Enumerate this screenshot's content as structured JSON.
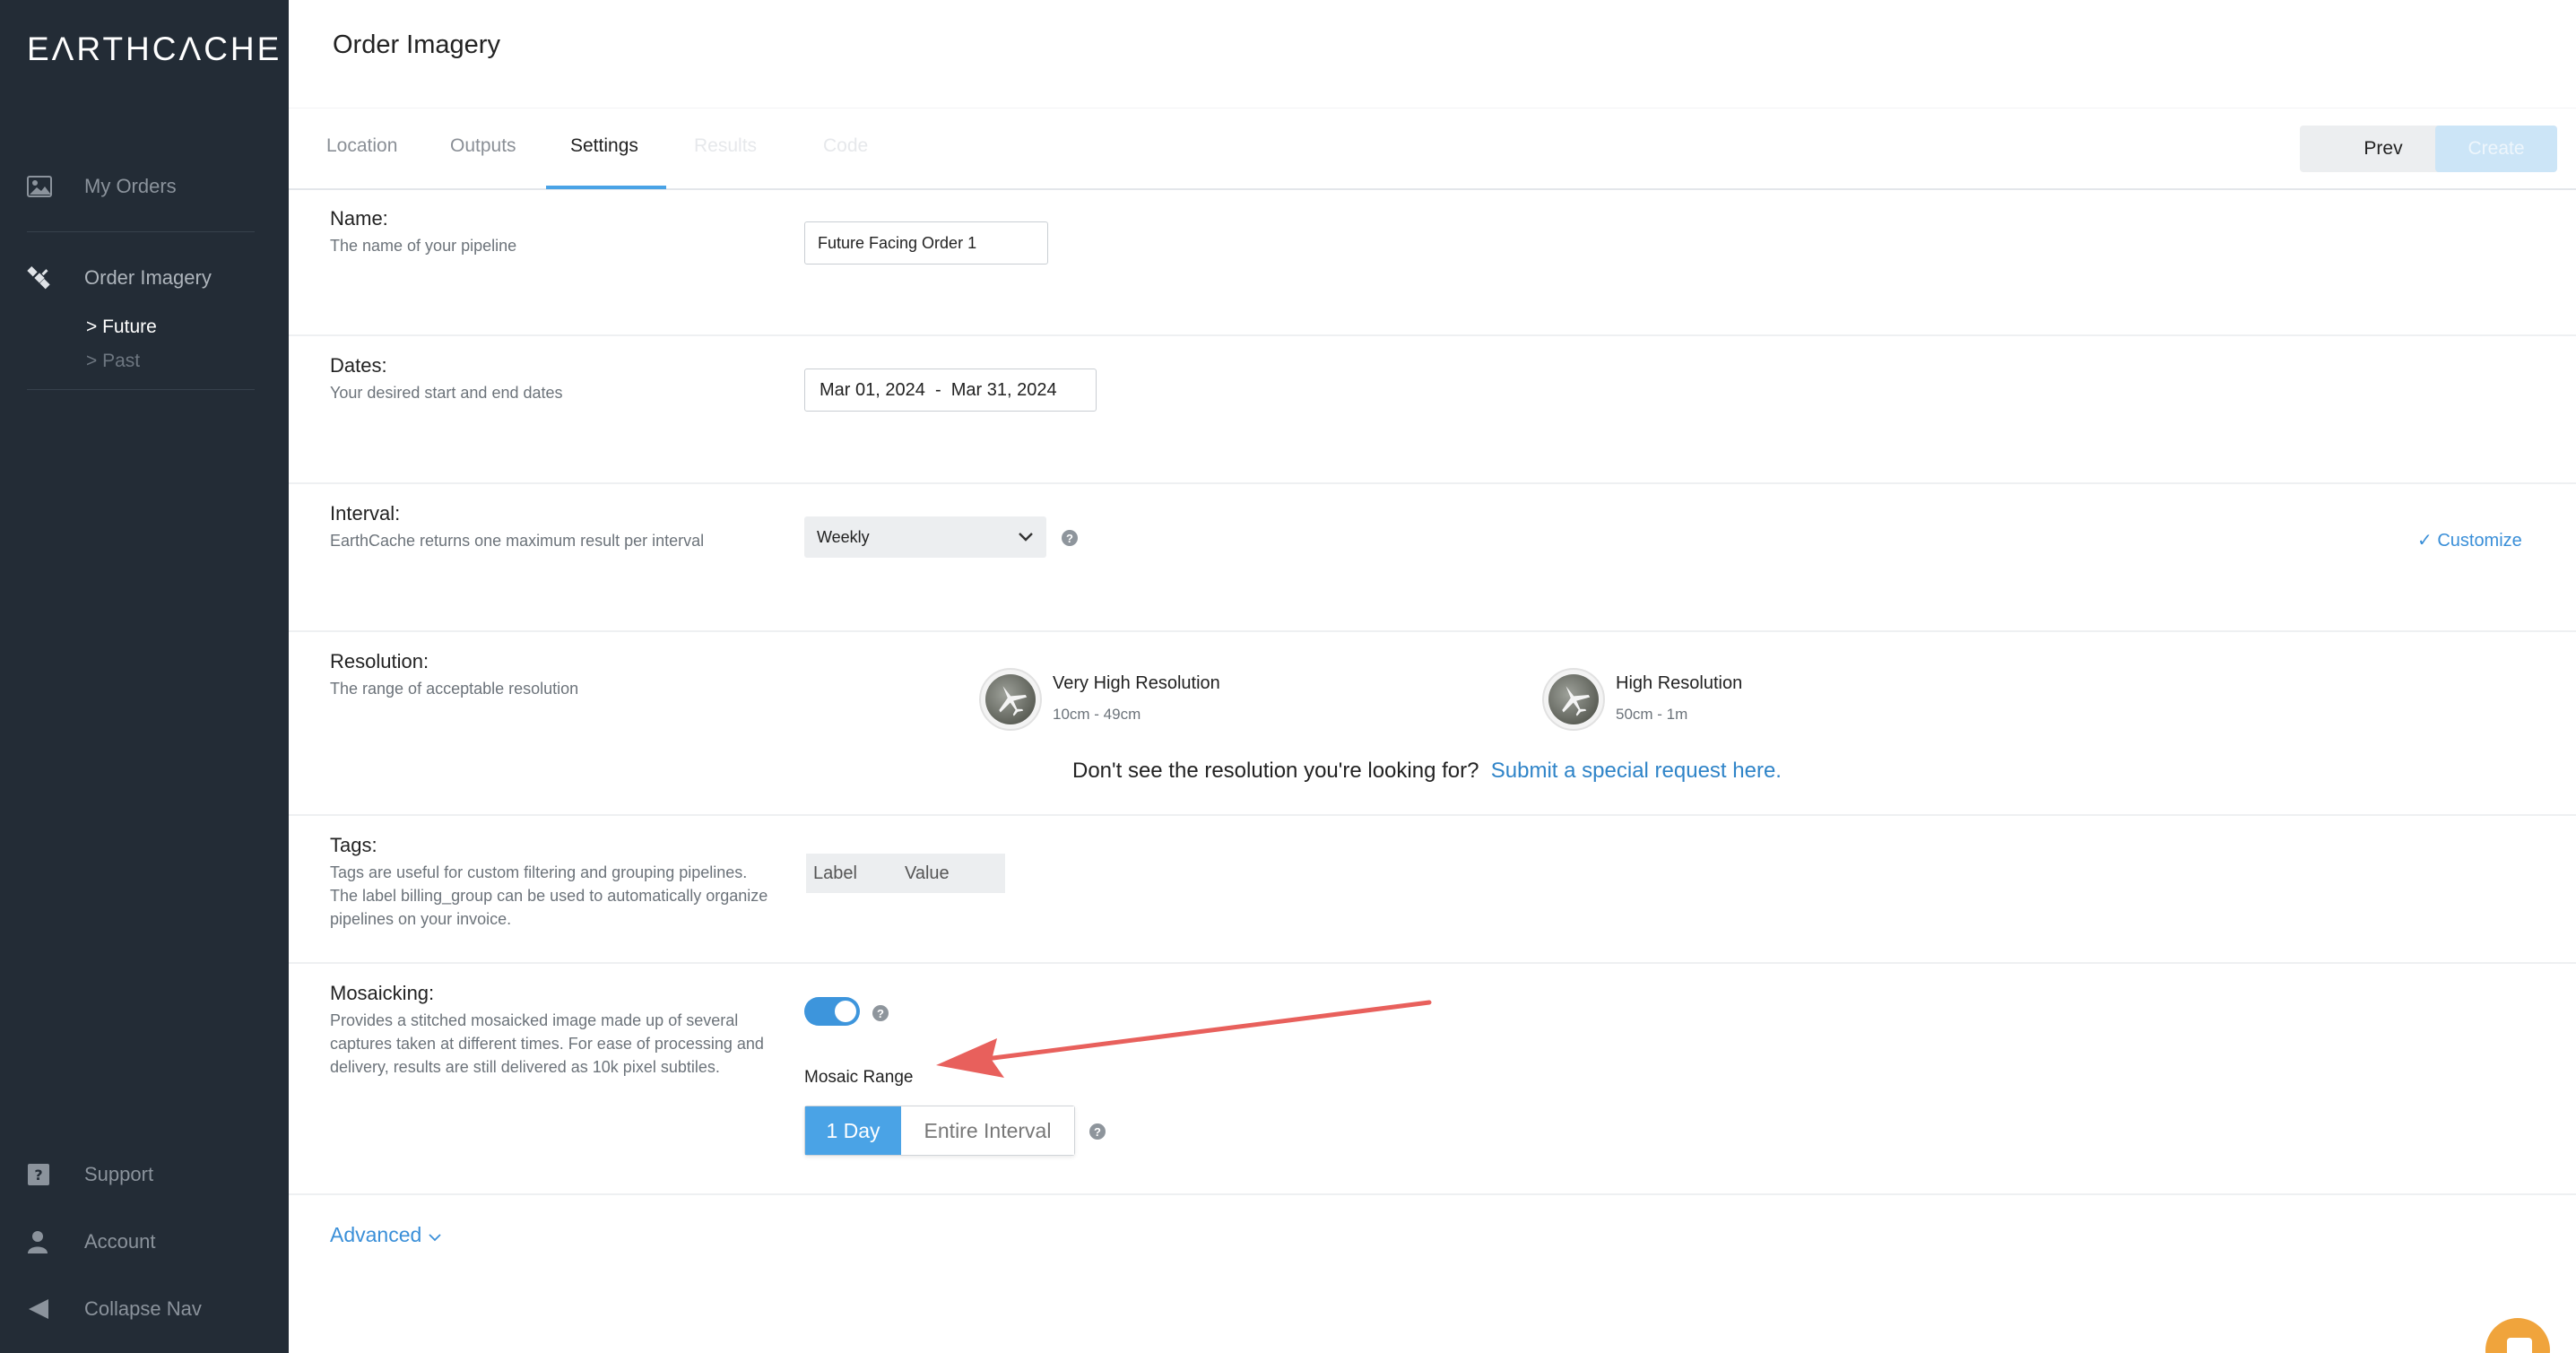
{
  "sidebar": {
    "logo": "EΛRTHCΛCHE",
    "items": [
      {
        "label": "My Orders",
        "icon": "image-icon"
      },
      {
        "label": "Order Imagery",
        "icon": "satellite-icon"
      }
    ],
    "sub_items": [
      "> Future",
      "> Past"
    ],
    "bottom": [
      {
        "label": "Support",
        "icon": "question-icon"
      },
      {
        "label": "Account",
        "icon": "user-icon"
      },
      {
        "label": "Collapse Nav",
        "icon": "triangle-left-icon"
      }
    ]
  },
  "header": {
    "title": "Order Imagery",
    "tabs": [
      "Location",
      "Outputs",
      "Settings",
      "Results",
      "Code"
    ],
    "active_tab": "Settings",
    "prev_label": "Prev",
    "create_label": "Create"
  },
  "name_section": {
    "title": "Name:",
    "desc": "The name of your pipeline",
    "value": "Future Facing Order 1"
  },
  "dates_section": {
    "title": "Dates:",
    "desc": "Your desired start and end dates",
    "value": "Mar 01, 2024  -  Mar 31, 2024"
  },
  "interval_section": {
    "title": "Interval:",
    "desc": "EarthCache returns one maximum result per interval",
    "value": "Weekly",
    "customize": "✓ Customize"
  },
  "resolution_section": {
    "title": "Resolution:",
    "desc": "The range of acceptable resolution",
    "options": [
      {
        "name": "Very High Resolution",
        "range": "10cm - 49cm"
      },
      {
        "name": "High Resolution",
        "range": "50cm - 1m"
      }
    ],
    "note": "Don't see the resolution you're looking for?",
    "note_link": "Submit a special request here."
  },
  "tags_section": {
    "title": "Tags:",
    "desc": "Tags are useful for custom filtering and grouping pipelines. The label billing_group can be used to automatically organize pipelines on your invoice.",
    "label_placeholder": "Label",
    "value_placeholder": "Value"
  },
  "mosaic_section": {
    "title": "Mosaicking:",
    "desc": "Provides a stitched mosaicked image made up of several captures taken at different times. For ease of processing and delivery, results are still delivered as 10k pixel subtiles.",
    "toggle_on": true,
    "range_label": "Mosaic Range",
    "options": [
      "1 Day",
      "Entire Interval"
    ],
    "selected": "1 Day"
  },
  "advanced_label": "Advanced",
  "colors": {
    "accent": "#4aa3e6",
    "sidebar": "#232c36",
    "annotation_arrow": "#e8605c"
  }
}
